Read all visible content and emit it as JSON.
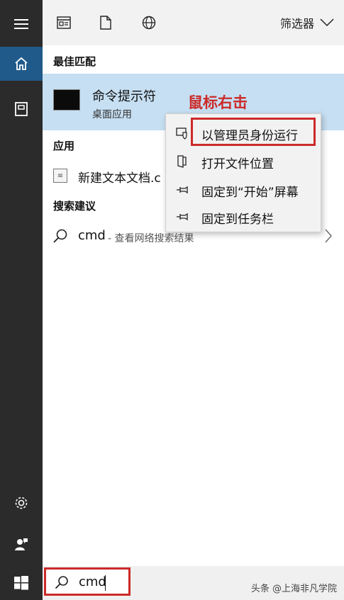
{
  "top": {
    "filter_label": "筛选器",
    "icons": [
      "apps-icon",
      "document-icon",
      "web-icon"
    ]
  },
  "sections": {
    "best_match": "最佳匹配",
    "apps": "应用",
    "search_suggestions": "搜索建议"
  },
  "best_match": {
    "title": "命令提示符",
    "subtitle": "桌面应用"
  },
  "annotation": "鼠标右击",
  "apps_item": {
    "label": "新建文本文档.c"
  },
  "suggestion": {
    "term": "cmd",
    "desc": "- 查看网络搜索结果"
  },
  "context_menu": {
    "items": [
      {
        "label": "以管理员身份运行",
        "icon": "shield-icon"
      },
      {
        "label": "打开文件位置",
        "icon": "folder-icon"
      },
      {
        "label": "固定到“开始”屏幕",
        "icon": "pin-icon"
      },
      {
        "label": "固定到任务栏",
        "icon": "pin-icon"
      }
    ]
  },
  "search": {
    "value": "cmd"
  },
  "watermark": "头条 @上海非凡学院",
  "colors": {
    "accent": "#1f5a8a",
    "highlight": "#c6dff2",
    "annotation": "#cc2a2a"
  }
}
